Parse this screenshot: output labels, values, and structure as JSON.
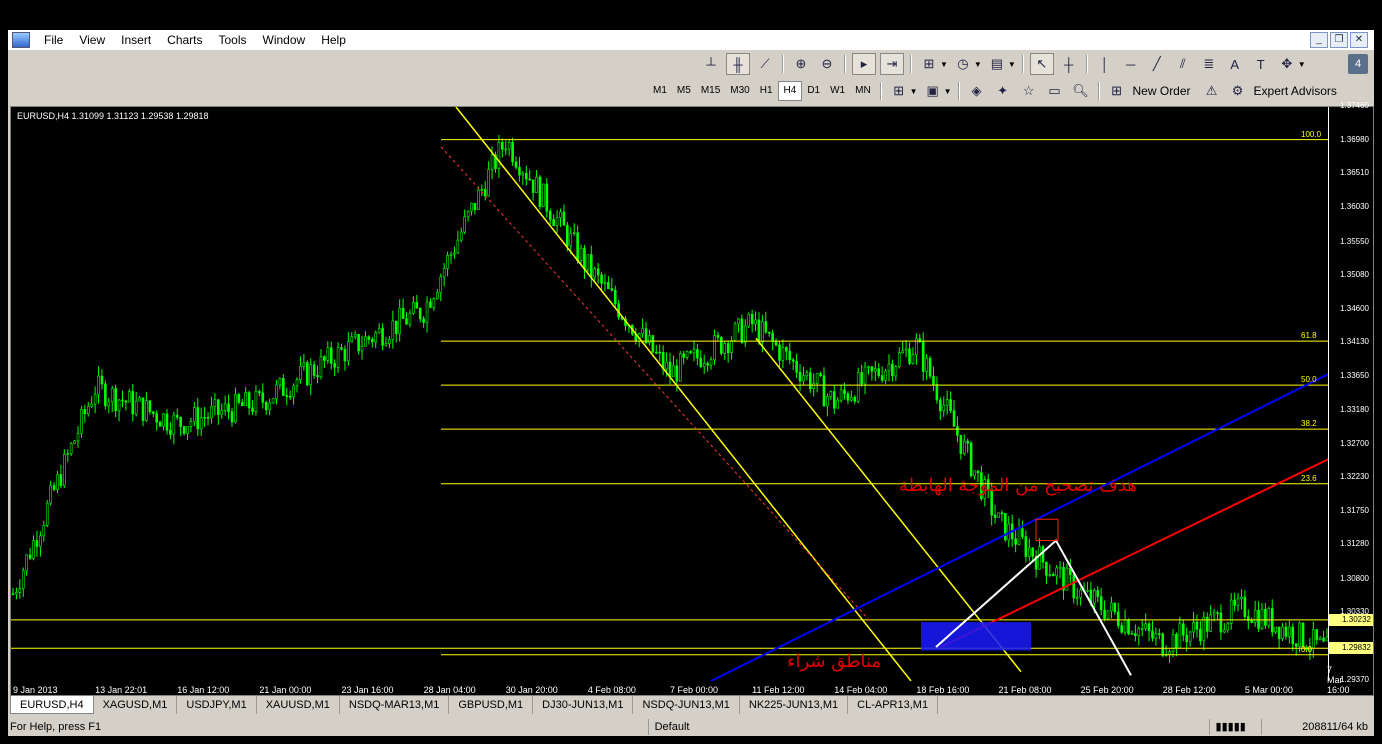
{
  "menu": [
    "File",
    "View",
    "Insert",
    "Charts",
    "Tools",
    "Window",
    "Help"
  ],
  "timeframes": [
    "M1",
    "M5",
    "M15",
    "M30",
    "H1",
    "H4",
    "D1",
    "W1",
    "MN"
  ],
  "active_timeframe": "H4",
  "toolbar": {
    "new_order": "New Order",
    "expert_advisors": "Expert Advisors"
  },
  "chart": {
    "title": "EURUSD,H4  1.31099 1.31123 1.29538 1.29818",
    "price_ticks": [
      "1.37460",
      "1.36980",
      "1.36510",
      "1.36030",
      "1.35550",
      "1.35080",
      "1.34600",
      "1.34130",
      "1.33650",
      "1.33180",
      "1.32700",
      "1.32230",
      "1.31750",
      "1.31280",
      "1.30800",
      "1.30330",
      "1.29370"
    ],
    "price_marks": [
      "1.30232",
      "1.29832"
    ],
    "time_ticks": [
      "9 Jan 2013",
      "13 Jan 22:01",
      "16 Jan 12:00",
      "21 Jan 00:00",
      "23 Jan 16:00",
      "28 Jan 04:00",
      "30 Jan 20:00",
      "4 Feb 08:00",
      "7 Feb 00:00",
      "11 Feb 12:00",
      "14 Feb 04:00",
      "18 Feb 16:00",
      "21 Feb 08:00",
      "25 Feb 20:00",
      "28 Feb 12:00",
      "5 Mar 00:00",
      "7 Mar 16:00"
    ],
    "fib_levels": [
      "100.0",
      "61.8",
      "50.0",
      "38.2",
      "23.6",
      "0.0"
    ],
    "annotation_target": "هدف تصحيح من الموجة الهابطة",
    "annotation_buy": "مناطق شراء",
    "colors": {
      "candles": "#00ff00",
      "fib": "#ffff00",
      "channel": "#ffff00",
      "trend_blue": "#0000ff",
      "trend_red": "#ff0000"
    }
  },
  "chart_data": {
    "type": "line",
    "title": "EURUSD,H4",
    "x": [
      "9 Jan 2013",
      "13 Jan 22:01",
      "16 Jan 12:00",
      "21 Jan 00:00",
      "23 Jan 16:00",
      "28 Jan 04:00",
      "30 Jan 20:00",
      "4 Feb 08:00",
      "7 Feb 00:00",
      "11 Feb 12:00",
      "14 Feb 04:00",
      "18 Feb 16:00",
      "21 Feb 08:00",
      "25 Feb 20:00",
      "28 Feb 12:00",
      "5 Mar 00:00",
      "7 Mar 16:00"
    ],
    "series": [
      {
        "values": [
          1.306,
          1.335,
          1.33,
          1.333,
          1.34,
          1.346,
          1.37,
          1.352,
          1.337,
          1.344,
          1.333,
          1.341,
          1.316,
          1.306,
          1.299,
          1.304,
          1.298
        ]
      }
    ],
    "ylim": [
      1.2937,
      1.3746
    ]
  },
  "tabs": [
    "EURUSD,H4",
    "XAGUSD,M1",
    "USDJPY,M1",
    "XAUUSD,M1",
    "NSDQ-MAR13,M1",
    "GBPUSD,M1",
    "DJ30-JUN13,M1",
    "NSDQ-JUN13,M1",
    "NK225-JUN13,M1",
    "CL-APR13,M1"
  ],
  "active_tab": "EURUSD,H4",
  "status": {
    "help": "For Help, press F1",
    "profile": "Default",
    "traffic": "208811/64 kb"
  }
}
